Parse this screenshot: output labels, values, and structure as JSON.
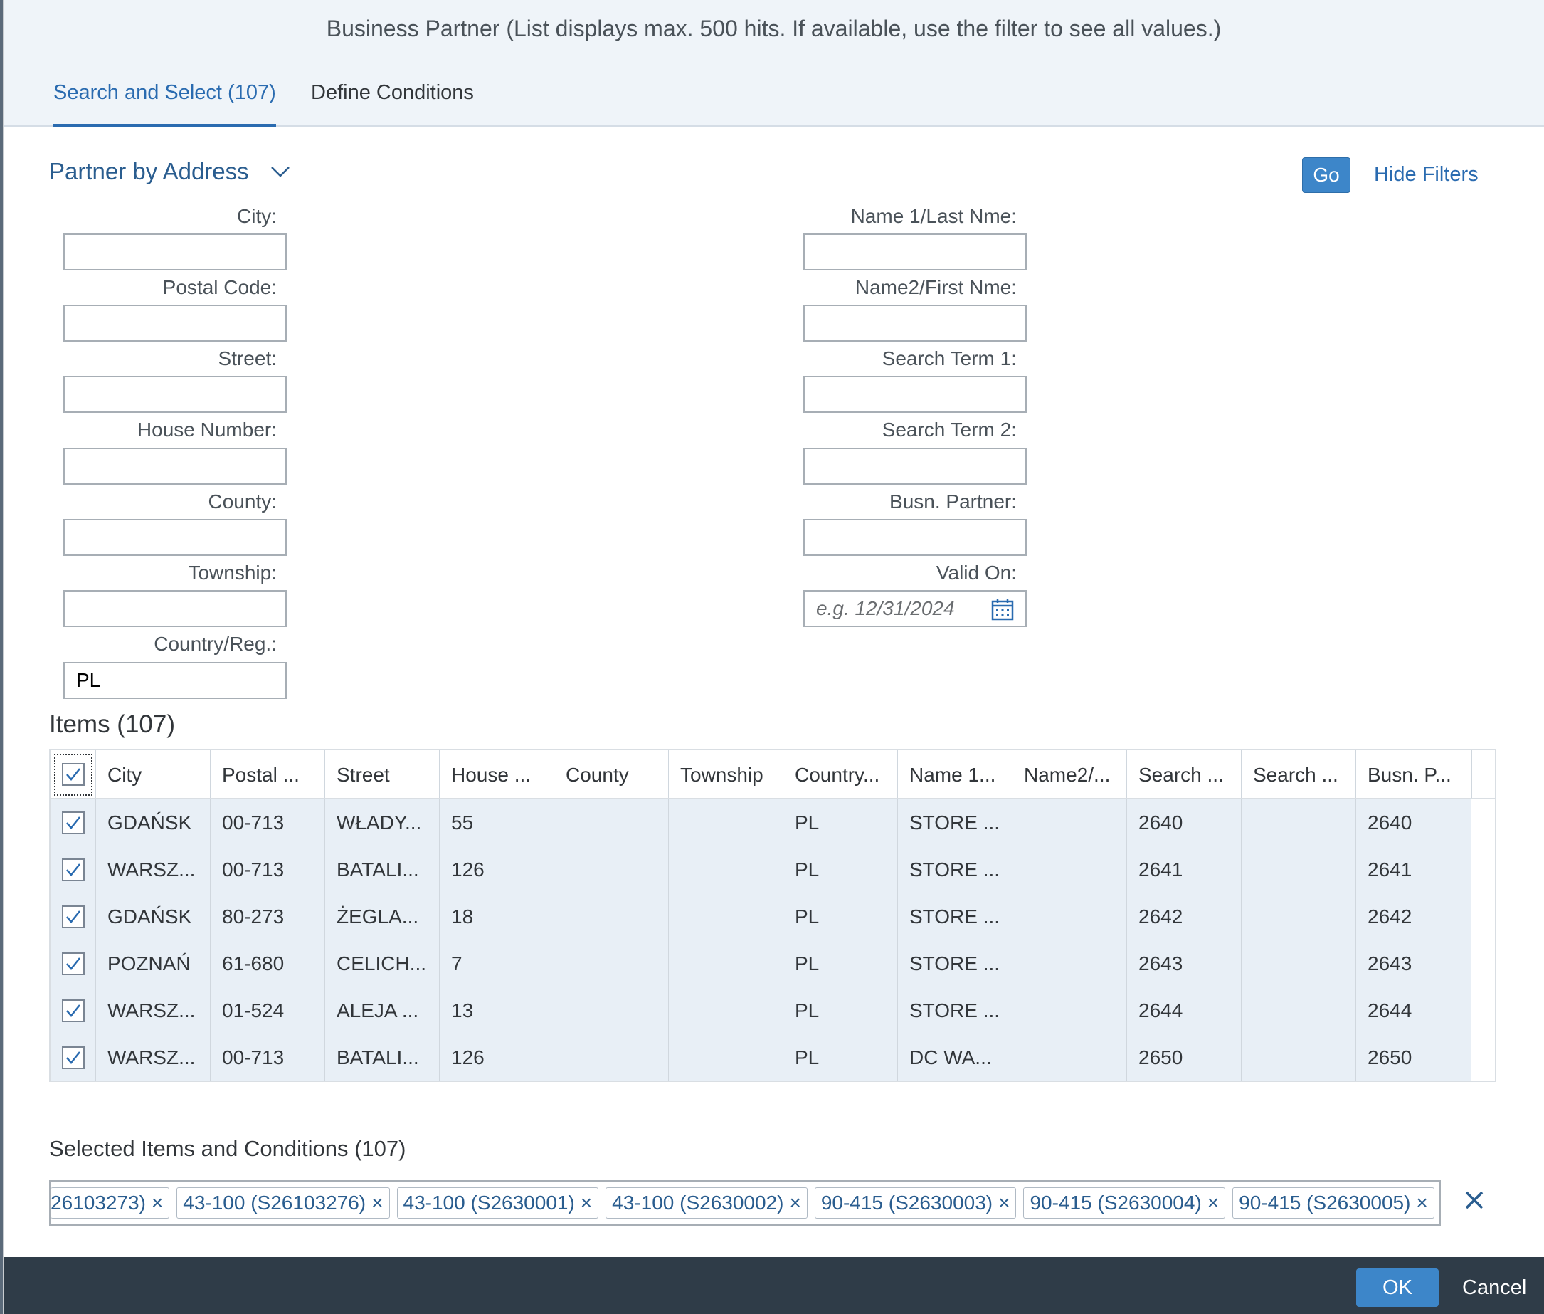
{
  "dialog": {
    "title": "Business Partner (List displays max. 500 hits. If available, use the filter to see all values.)"
  },
  "tabs": [
    {
      "label": "Search and Select (107)",
      "active": true
    },
    {
      "label": "Define Conditions",
      "active": false
    }
  ],
  "filterbar": {
    "variant": "Partner by Address",
    "go_label": "Go",
    "hide_filters_label": "Hide Filters",
    "left_fields": [
      {
        "label": "City:",
        "value": ""
      },
      {
        "label": "Postal Code:",
        "value": ""
      },
      {
        "label": "Street:",
        "value": ""
      },
      {
        "label": "House Number:",
        "value": ""
      },
      {
        "label": "County:",
        "value": ""
      },
      {
        "label": "Township:",
        "value": ""
      },
      {
        "label": "Country/Reg.:",
        "value": "PL"
      }
    ],
    "right_fields": [
      {
        "label": "Name 1/Last Nme:",
        "value": ""
      },
      {
        "label": "Name2/First Nme:",
        "value": ""
      },
      {
        "label": "Search Term 1:",
        "value": ""
      },
      {
        "label": "Search Term 2:",
        "value": ""
      },
      {
        "label": "Busn. Partner:",
        "value": ""
      },
      {
        "label": "Valid On:",
        "value": "",
        "placeholder": "e.g. 12/31/2024"
      }
    ]
  },
  "items": {
    "title": "Items (107)",
    "columns": [
      "City",
      "Postal ...",
      "Street",
      "House ...",
      "County",
      "Township",
      "Country...",
      "Name 1...",
      "Name2/...",
      "Search ...",
      "Search ...",
      "Busn. P..."
    ],
    "rows": [
      [
        "GDAŃSK",
        "00-713",
        "WŁADY...",
        "55",
        "",
        "",
        "PL",
        "STORE ...",
        "",
        "2640",
        "",
        "2640"
      ],
      [
        "WARSZ...",
        "00-713",
        "BATALI...",
        "126",
        "",
        "",
        "PL",
        "STORE ...",
        "",
        "2641",
        "",
        "2641"
      ],
      [
        "GDAŃSK",
        "80-273",
        "ŻEGLA...",
        "18",
        "",
        "",
        "PL",
        "STORE ...",
        "",
        "2642",
        "",
        "2642"
      ],
      [
        "POZNAŃ",
        "61-680",
        "CELICH...",
        "7",
        "",
        "",
        "PL",
        "STORE ...",
        "",
        "2643",
        "",
        "2643"
      ],
      [
        "WARSZ...",
        "01-524",
        "ALEJA ...",
        "13",
        "",
        "",
        "PL",
        "STORE ...",
        "",
        "2644",
        "",
        "2644"
      ],
      [
        "WARSZ...",
        "00-713",
        "BATALI...",
        "126",
        "",
        "",
        "PL",
        "DC WA...",
        "",
        "2650",
        "",
        "2650"
      ]
    ]
  },
  "selected": {
    "title": "Selected Items and Conditions (107)",
    "tokens": [
      "26103273)",
      "43-100 (S26103276)",
      "43-100 (S2630001)",
      "43-100 (S2630002)",
      "90-415 (S2630003)",
      "90-415 (S2630004)",
      "90-415 (S2630005)"
    ],
    "remove_glyph": "×"
  },
  "footer": {
    "ok_label": "OK",
    "cancel_label": "Cancel"
  },
  "colors": {
    "accent": "#2a6bb0",
    "button": "#3d86c9",
    "footer": "#2f3c48"
  }
}
